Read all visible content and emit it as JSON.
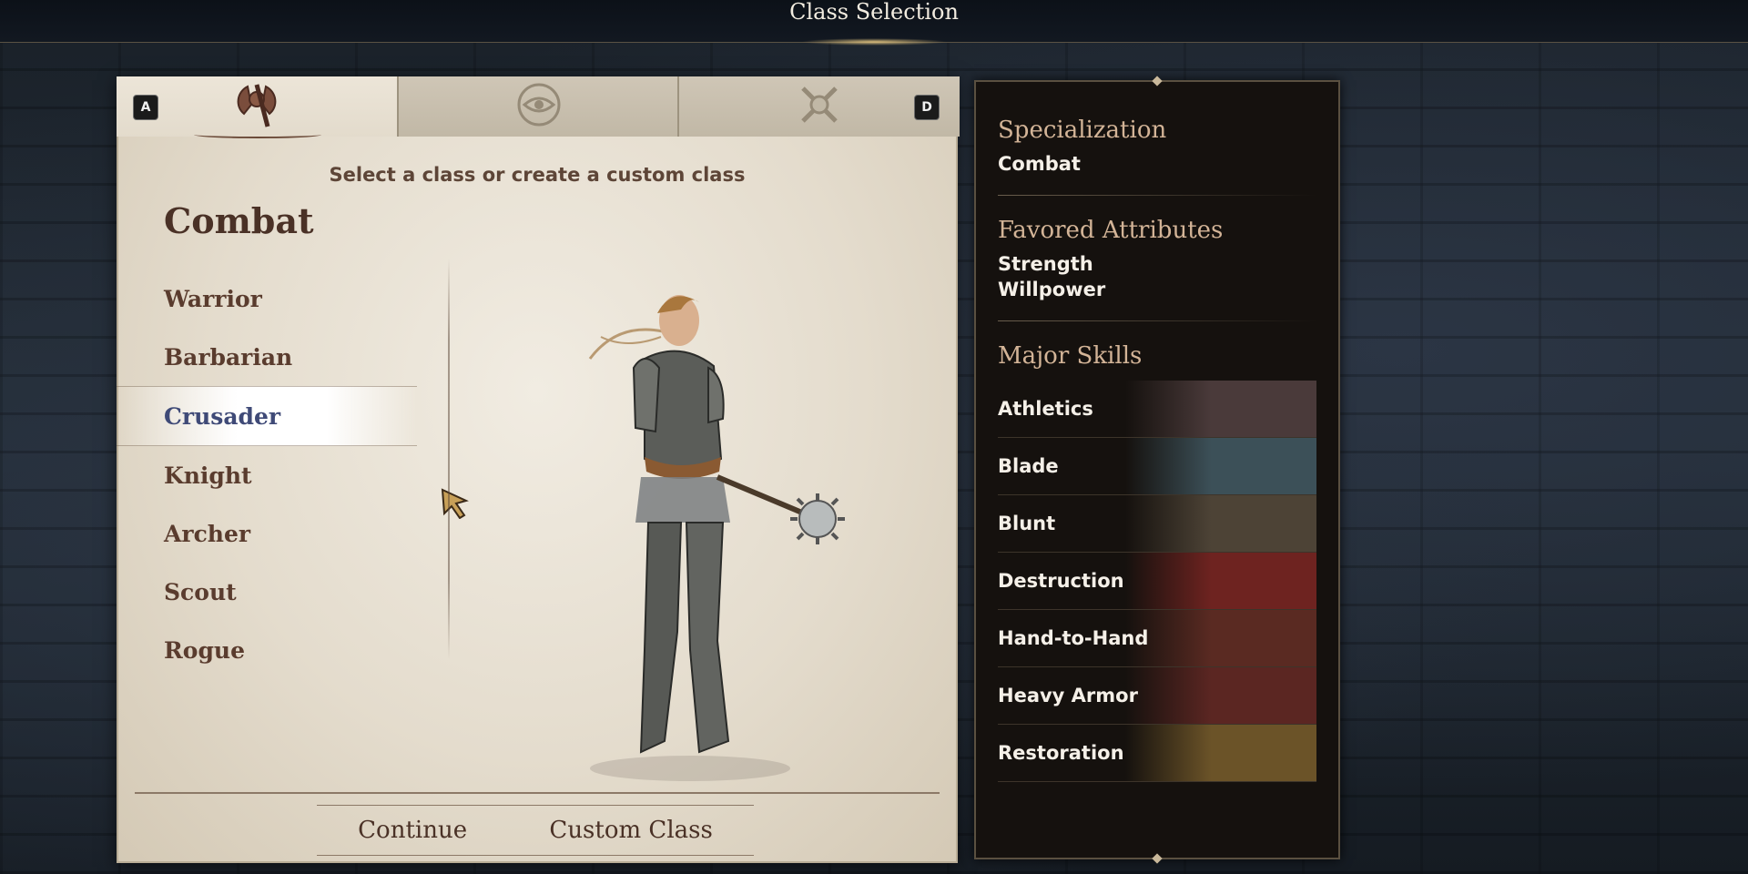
{
  "screen": {
    "title": "Class Selection"
  },
  "tabs": {
    "prev_key": "A",
    "next_key": "D",
    "items": [
      {
        "icon": "axe-shield-icon",
        "active": true
      },
      {
        "icon": "eye-emblem-icon",
        "active": false
      },
      {
        "icon": "crossed-keys-icon",
        "active": false
      }
    ]
  },
  "panel": {
    "subtitle": "Select a class or create a custom class",
    "category": "Combat",
    "classes": [
      "Warrior",
      "Barbarian",
      "Crusader",
      "Knight",
      "Archer",
      "Scout",
      "Rogue"
    ],
    "selected_class": "Crusader"
  },
  "footer": {
    "continue_label": "Continue",
    "custom_label": "Custom Class"
  },
  "info": {
    "specialization_heading": "Specialization",
    "specialization_value": "Combat",
    "attributes_heading": "Favored Attributes",
    "attributes": [
      "Strength",
      "Willpower"
    ],
    "skills_heading": "Major Skills",
    "skills": [
      {
        "label": "Athletics",
        "art_color": "#4a3a3a"
      },
      {
        "label": "Blade",
        "art_color": "#3c5058"
      },
      {
        "label": "Blunt",
        "art_color": "#4d4336"
      },
      {
        "label": "Destruction",
        "art_color": "#6e2320"
      },
      {
        "label": "Hand-to-Hand",
        "art_color": "#5a2a22"
      },
      {
        "label": "Heavy Armor",
        "art_color": "#5b2622"
      },
      {
        "label": "Restoration",
        "art_color": "#6b5328"
      }
    ]
  },
  "colors": {
    "accent_heading": "#d3b497",
    "selected_class": "#3f4a77",
    "parchment_text": "#5a3c2e"
  }
}
